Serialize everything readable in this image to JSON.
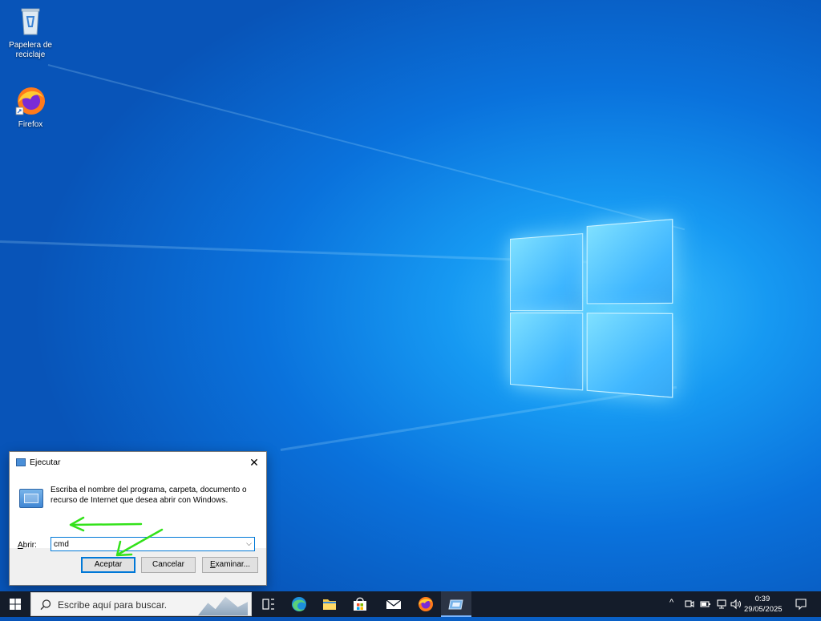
{
  "desktop": {
    "icons": [
      {
        "label": "Papelera de reciclaje"
      },
      {
        "label": "Firefox"
      }
    ]
  },
  "run_dialog": {
    "title": "Ejecutar",
    "description": "Escriba el nombre del programa, carpeta, documento o recurso de Internet que desea abrir con Windows.",
    "open_label_accel": "A",
    "open_label_rest": "brir:",
    "command_value": "cmd",
    "ok_label": "Aceptar",
    "cancel_label": "Cancelar",
    "browse_label_accel": "E",
    "browse_label_rest": "xaminar..."
  },
  "taskbar": {
    "search_placeholder": "Escribe aquí para buscar.",
    "clock_time": "0:39",
    "clock_date": "29/05/2025"
  },
  "colors": {
    "accent": "#0078d7",
    "annotation_arrow": "#33e21a",
    "taskbar_bg": "#141c2a"
  }
}
